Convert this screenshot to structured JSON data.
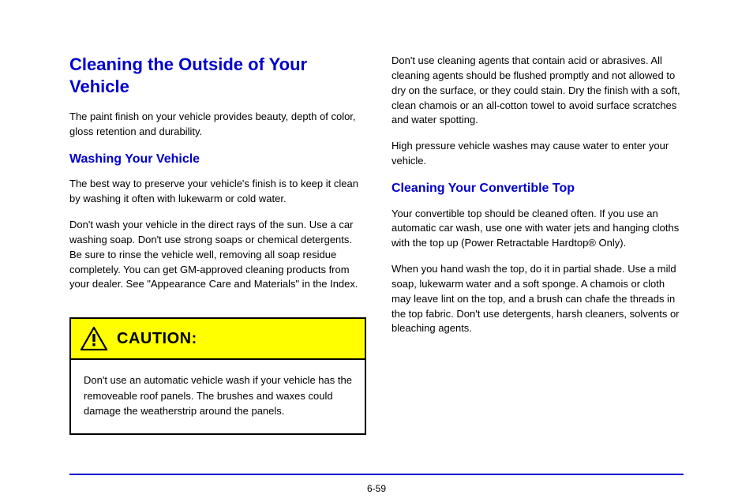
{
  "left": {
    "title": "Cleaning the Outside of Your Vehicle",
    "para1": "The paint finish on your vehicle provides beauty, depth of color, gloss retention and durability.",
    "sub1": "Washing Your Vehicle",
    "para2": "The best way to preserve your vehicle's finish is to keep it clean by washing it often with lukewarm or cold water.",
    "para3": "Don't wash your vehicle in the direct rays of the sun. Use a car washing soap. Don't use strong soaps or chemical detergents. Be sure to rinse the vehicle well, removing all soap residue completely. You can get GM-approved cleaning products from your dealer. See \"Appearance Care and Materials\" in the Index.",
    "caution": {
      "label": "CAUTION:",
      "body": "Don't use an automatic vehicle wash if your vehicle has the removeable roof panels. The brushes and waxes could damage the weatherstrip around the panels."
    }
  },
  "right": {
    "para1": "Don't use cleaning agents that contain acid or abrasives. All cleaning agents should be flushed promptly and not allowed to dry on the surface, or they could stain. Dry the finish with a soft, clean chamois or an all-cotton towel to avoid surface scratches and water spotting.",
    "para2": "High pressure vehicle washes may cause water to enter your vehicle.",
    "sub1": "Cleaning Your Convertible Top",
    "para3_a": "Your convertible top should be cleaned often. If you use an automatic car wash, use one with water jets and hanging cloths with the top up (Power Retractable Hardtop",
    "reg": "®",
    "para3_b": " Only).",
    "para4": "When you hand wash the top, do it in partial shade. Use a mild soap, lukewarm water and a soft sponge. A chamois or cloth may leave lint on the top, and a brush can chafe the threads in the top fabric. Don't use detergents, harsh cleaners, solvents or bleaching agents."
  },
  "page": "6-59"
}
